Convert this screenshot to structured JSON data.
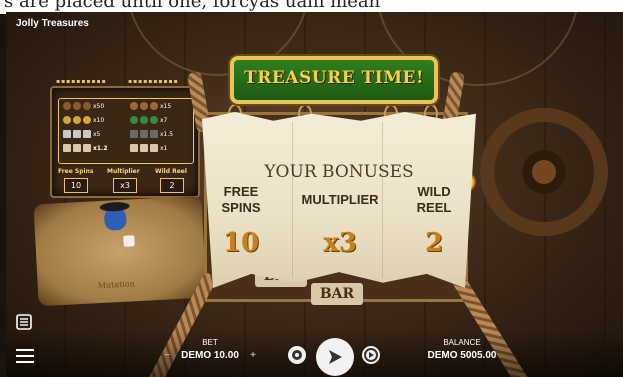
{
  "top_cropped_text": "s are placed until one, forcyas ualli mean",
  "game_title": "Jolly Treasures",
  "banner_title": "TREASURE TIME!",
  "bonus_panel": {
    "heading": "YOUR BONUSES",
    "items": [
      {
        "label_line1": "FREE",
        "label_line2": "SPINS",
        "value": "10"
      },
      {
        "label_line1": "MULTIPLIER",
        "label_line2": "",
        "value": "x3"
      },
      {
        "label_line1": "WILD",
        "label_line2": "REEL",
        "value": "2"
      }
    ]
  },
  "paytable": {
    "rows": [
      {
        "left": "x50",
        "right": "x15"
      },
      {
        "left": "x10",
        "right": "x7"
      },
      {
        "left": "x5",
        "right": "x1.5"
      },
      {
        "left": "x1.2",
        "right": "x1"
      }
    ],
    "features": [
      {
        "label": "Free Spins",
        "value": "10"
      },
      {
        "label": "Multiplier",
        "value": "x3"
      },
      {
        "label": "Wild Reel",
        "value": "2"
      }
    ]
  },
  "map_text": "Mutation",
  "reel_symbols": [
    "BAR",
    "BAR"
  ],
  "hud": {
    "bet_label": "BET",
    "bet_value": "DEMO 10.00",
    "minus": "−",
    "plus": "+",
    "balance_label": "BALANCE",
    "balance_value": "DEMO 5005.00"
  },
  "colors": {
    "banner_green": "#2f7f1f",
    "gold": "#e9c45a",
    "bonus_value": "#c8811a",
    "sail": "#f3ecd8"
  },
  "icons": [
    "paytable-icon",
    "menu-icon",
    "autoplay-icon",
    "spin-icon",
    "turbo-icon",
    "steering-wheel-icon",
    "torch-icon"
  ]
}
